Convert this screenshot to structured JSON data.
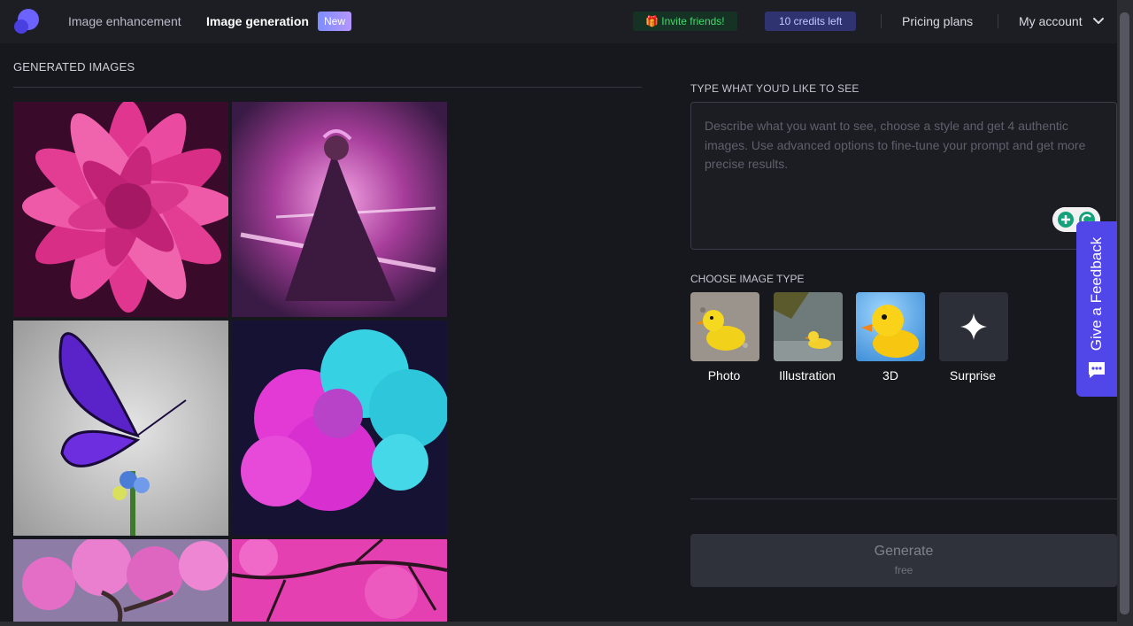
{
  "nav": {
    "link_enhancement": "Image enhancement",
    "link_generation": "Image generation",
    "badge_new": "New",
    "invite": "🎁 Invite friends!",
    "credits": "10 credits left",
    "pricing": "Pricing plans",
    "account": "My account"
  },
  "left": {
    "title": "GENERATED IMAGES",
    "images": [
      "pink-flower",
      "magenta-sorceress",
      "purple-butterfly",
      "pink-cyan-smoke",
      "pink-bonsai-tree",
      "pink-blossom-branches"
    ]
  },
  "right": {
    "prompt_label": "TYPE WHAT YOU'D LIKE TO SEE",
    "prompt_placeholder": "Describe what you want to see, choose a style and get 4 authentic images. Use advanced options to fine-tune your prompt and get more precise results.",
    "prompt_value": "",
    "type_label": "CHOOSE IMAGE TYPE",
    "types": [
      {
        "label": "Photo"
      },
      {
        "label": "Illustration"
      },
      {
        "label": "3D"
      },
      {
        "label": "Surprise"
      }
    ],
    "generate_label": "Generate",
    "generate_sub": "free"
  },
  "feedback": {
    "label": "Give a Feedback"
  },
  "colors": {
    "accent": "#5146e8",
    "background": "#17181d",
    "nav_bg": "#1d1e24",
    "invite_text": "#43d96b",
    "credits_bg": "#2f3470"
  }
}
